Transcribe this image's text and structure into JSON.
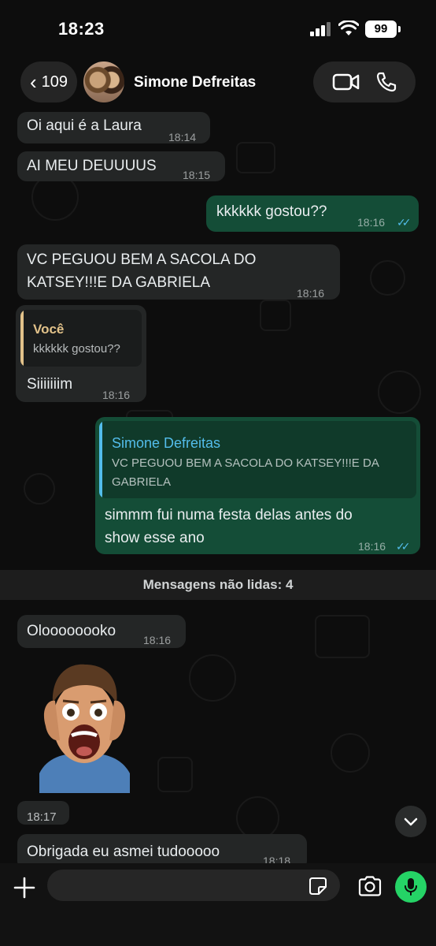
{
  "status_bar": {
    "time": "18:23",
    "battery": "99"
  },
  "header": {
    "back_count": "109",
    "contact_name": "Simone Defreitas"
  },
  "messages": [
    {
      "type": "incoming",
      "text": "Oi aqui é a Laura",
      "time": "18:14"
    },
    {
      "type": "incoming",
      "text": "AI MEU DEUUUUS",
      "time": "18:15"
    },
    {
      "type": "outgoing",
      "text": "kkkkkk gostou??",
      "time": "18:16",
      "status": "read"
    },
    {
      "type": "incoming",
      "text_line1": "VC PEGUOU BEM A SACOLA DO",
      "text_line2": "KATSEY!!!E DA GABRIELA",
      "time": "18:16"
    },
    {
      "type": "incoming",
      "reply_to_name": "Você",
      "reply_to_text": "kkkkkk gostou??",
      "text": "Siiiiiiim",
      "time": "18:16"
    },
    {
      "type": "outgoing",
      "reply_to_name": "Simone Defreitas",
      "reply_to_text_line1": "VC PEGUOU BEM A SACOLA DO KATSEY!!!E DA",
      "reply_to_text_line2": "GABRIELA",
      "text_line1": "simmm fui numa festa delas antes do",
      "text_line2": "show esse ano",
      "time": "18:16",
      "status": "read"
    },
    {
      "type": "incoming",
      "text": "Oloooooooko",
      "time": "18:16"
    },
    {
      "type": "sticker",
      "time": "18:17"
    },
    {
      "type": "incoming",
      "text": "Obrigada eu asmei tudooooo",
      "time": "18:18"
    }
  ],
  "unread_divider": "Mensagens não lidas: 4",
  "colors": {
    "incoming_bubble": "#242626",
    "outgoing_bubble": "#144d37",
    "read_ticks": "#53bdeb",
    "mic_button": "#25d366",
    "quote_self": "#e2c28a",
    "quote_other": "#53bdeb"
  },
  "icons": [
    "chevron-left-icon",
    "video-call-icon",
    "phone-icon",
    "chevron-down-icon",
    "plus-icon",
    "sticker-icon",
    "camera-icon",
    "microphone-icon"
  ]
}
